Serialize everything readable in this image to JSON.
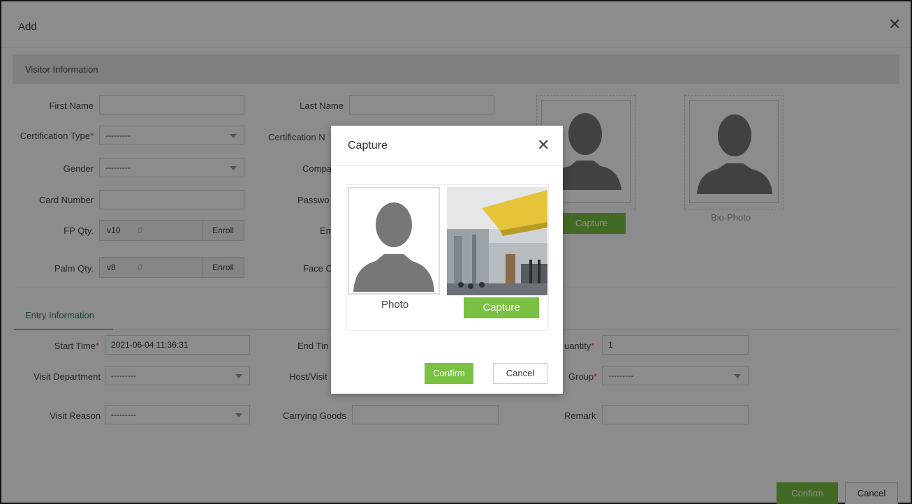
{
  "dialog": {
    "title": "Add"
  },
  "visitor": {
    "section_title": "Visitor Information",
    "first_name": {
      "label": "First Name",
      "value": ""
    },
    "last_name": {
      "label": "Last Name",
      "value": ""
    },
    "cert_type": {
      "label": "Certification Type",
      "value": "---------"
    },
    "cert_no": {
      "label": "Certification N"
    },
    "gender": {
      "label": "Gender",
      "value": "---------"
    },
    "company": {
      "label": "Compa"
    },
    "card_number": {
      "label": "Card Number",
      "value": ""
    },
    "password": {
      "label": "Passwo"
    },
    "fp": {
      "label": "FP Qty.",
      "version": "v10",
      "count": "0",
      "enroll": "Enroll"
    },
    "palm": {
      "label": "Palm Qty.",
      "version": "v8",
      "count": "0",
      "enroll": "Enroll"
    },
    "em": {
      "label": "Em"
    },
    "face": {
      "label": "Face C"
    },
    "photo_capture": "Capture",
    "bio_photo": "Bio-Photo"
  },
  "entry": {
    "tab": "Entry Information",
    "start_time": {
      "label": "Start Time",
      "value": "2021-06-04 11:36:31"
    },
    "end_time": {
      "label": "End Tin"
    },
    "quantity": {
      "label": "uantity",
      "value": "1"
    },
    "visit_dept": {
      "label": "Visit Department",
      "value": "---------"
    },
    "host": {
      "label": "Host/Visit"
    },
    "group": {
      "label": "Group",
      "value": "---------"
    },
    "visit_reason": {
      "label": "Visit Reason",
      "value": "---------"
    },
    "carrying_goods": {
      "label": "Carrying Goods",
      "value": ""
    },
    "remark": {
      "label": "Remark",
      "value": ""
    }
  },
  "footer": {
    "confirm": "Confirm",
    "cancel": "Cancel"
  },
  "modal": {
    "title": "Capture",
    "photo_label": "Photo",
    "capture": "Capture",
    "confirm": "Confirm",
    "cancel": "Cancel"
  },
  "colors": {
    "accent_green": "#7ac143",
    "tab_teal": "#2d7a6a",
    "required": "#e33333"
  }
}
